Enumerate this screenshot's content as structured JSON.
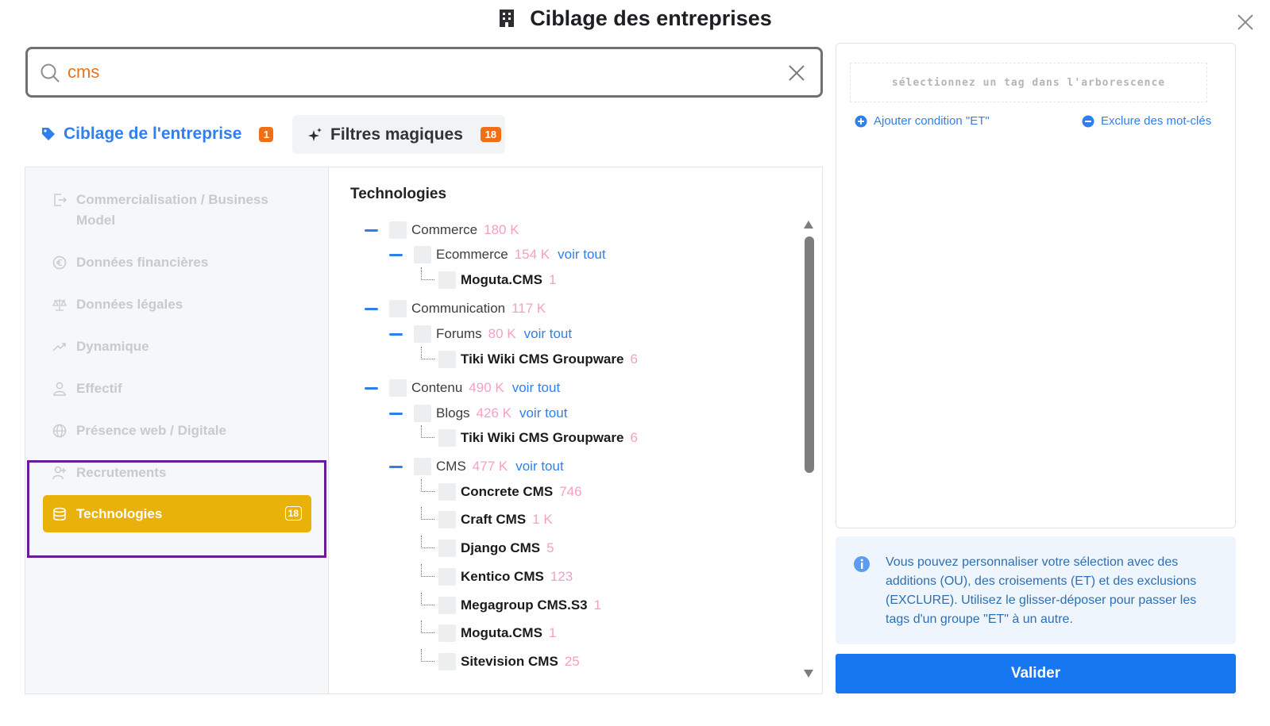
{
  "modal": {
    "title": "Ciblage des entreprises",
    "title_icon": "building-icon",
    "close_icon": "close-icon"
  },
  "search": {
    "value": "cms",
    "placeholder": "",
    "icon": "search-icon",
    "clear_icon": "clear-icon"
  },
  "tabs": [
    {
      "label": "Ciblage de l'entreprise",
      "badge": "1",
      "icon": "tag-icon",
      "color": "#2f80ed"
    },
    {
      "label": "Filtres magiques",
      "badge": "18",
      "icon": "sparkles-icon"
    }
  ],
  "sidebar": {
    "items": [
      {
        "label": "Commercialisation / Business Model",
        "icon": "exit-icon"
      },
      {
        "label": "Données financières",
        "icon": "euro-icon"
      },
      {
        "label": "Données légales",
        "icon": "scale-icon"
      },
      {
        "label": "Dynamique",
        "icon": "trend-up-icon"
      },
      {
        "label": "Effectif",
        "icon": "user-icon"
      },
      {
        "label": "Présence web / Digitale",
        "icon": "globe-icon"
      },
      {
        "label": "Recrutements",
        "icon": "user-plus-icon"
      },
      {
        "label": "Technologies",
        "icon": "database-icon",
        "badge": "18",
        "active": true,
        "color": "#e8b20b"
      }
    ]
  },
  "tree": {
    "title": "Technologies",
    "voir_tout_label": "voir tout",
    "nodes": [
      {
        "label": "Commerce",
        "count": "180 K"
      },
      {
        "label": "Ecommerce",
        "count": "154 K"
      },
      {
        "label": "Moguta.CMS",
        "count": "1"
      },
      {
        "label": "Communication",
        "count": "117 K"
      },
      {
        "label": "Forums",
        "count": "80 K"
      },
      {
        "label": "Tiki Wiki CMS Groupware",
        "count": "6"
      },
      {
        "label": "Contenu",
        "count": "490 K"
      },
      {
        "label": "Blogs",
        "count": "426 K"
      },
      {
        "label": "Tiki Wiki CMS Groupware",
        "count": "6"
      },
      {
        "label": "CMS",
        "count": "477 K"
      },
      {
        "label": "Concrete CMS",
        "count": "746"
      },
      {
        "label": "Craft CMS",
        "count": "1 K"
      },
      {
        "label": "Django CMS",
        "count": "5"
      },
      {
        "label": "Kentico CMS",
        "count": "123"
      },
      {
        "label": "Megagroup CMS.S3",
        "count": "1"
      },
      {
        "label": "Moguta.CMS",
        "count": "1"
      },
      {
        "label": "Sitevision CMS",
        "count": "25"
      }
    ]
  },
  "right_panel": {
    "drop_hint": "sélectionnez un tag dans l'arborescence",
    "add_condition": "Ajouter condition \"ET\"",
    "exclude_keywords": "Exclure des mot-clés",
    "info_text": "Vous pouvez personnaliser votre sélection avec des additions (OU), des croisements (ET) et des exclusions (EXCLURE). Utilisez le glisser-déposer pour passer les tags d'un groupe \"ET\" à un autre.",
    "validate_label": "Valider",
    "accent_color": "#1677f0"
  }
}
